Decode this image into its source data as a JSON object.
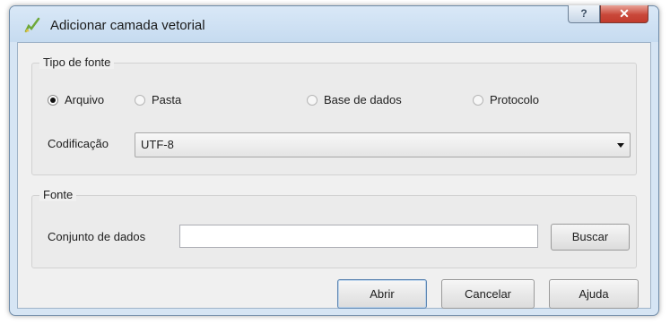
{
  "window": {
    "title": "Adicionar camada vetorial",
    "help_glyph": "?",
    "close_glyph": "✕"
  },
  "source_type": {
    "title": "Tipo de fonte",
    "options": [
      {
        "label": "Arquivo",
        "checked": true
      },
      {
        "label": "Pasta",
        "checked": false
      },
      {
        "label": "Base de dados",
        "checked": false
      },
      {
        "label": "Protocolo",
        "checked": false
      }
    ],
    "encoding_label": "Codificação",
    "encoding_value": "UTF-8"
  },
  "source": {
    "title": "Fonte",
    "dataset_label": "Conjunto de dados",
    "dataset_value": "",
    "browse_label": "Buscar"
  },
  "buttons": {
    "open": "Abrir",
    "cancel": "Cancelar",
    "help": "Ajuda"
  },
  "colors": {
    "frame": "#d6e5f4",
    "close_button": "#c9483a",
    "dialog_bg": "#f0f0f0"
  }
}
